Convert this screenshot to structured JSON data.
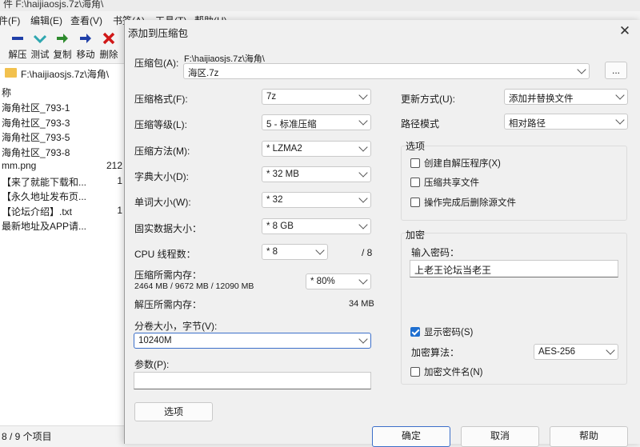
{
  "bg": {
    "title": "件 F:\\haijiaosjs.7z\\海角\\",
    "menu": [
      "件(F)",
      "编辑(E)",
      "查看(V)",
      "书签(A)",
      "工具(T)",
      "帮助(H)"
    ],
    "toolbar": [
      {
        "label": "解压",
        "icon": "minus-icon",
        "color": "#1f3fa8"
      },
      {
        "label": "测试",
        "icon": "check-icon",
        "color": "#2fa7b0"
      },
      {
        "label": "复制",
        "icon": "copy-arrow-icon",
        "color": "#2e8b2e"
      },
      {
        "label": "移动",
        "icon": "move-arrow-icon",
        "color": "#1f3fa8"
      },
      {
        "label": "删除",
        "icon": "delete-x-icon",
        "color": "#d01818"
      }
    ],
    "address": "F:\\haijiaosjs.7z\\海角\\",
    "list_header": "称",
    "files": [
      {
        "name": "海角社区_793-1",
        "size": ""
      },
      {
        "name": "海角社区_793-3",
        "size": ""
      },
      {
        "name": "海角社区_793-5",
        "size": ""
      },
      {
        "name": "海角社区_793-8",
        "size": ""
      },
      {
        "name": "mm.png",
        "size": "212"
      },
      {
        "name": "【来了就能下载和...",
        "size": "1"
      },
      {
        "name": "【永久地址发布页...",
        "size": ""
      },
      {
        "name": "【论坛介绍】.txt",
        "size": "1"
      },
      {
        "name": "最新地址及APP请...",
        "size": ""
      }
    ],
    "status": "8 / 9 个项目"
  },
  "dialog": {
    "title": "添加到压缩包",
    "archive_label": "压缩包(A):",
    "archive_path": "F:\\haijiaosjs.7z\\海角\\",
    "archive_name": "海区.7z",
    "browse_label": "...",
    "format_label": "压缩格式(F):",
    "format_value": "7z",
    "level_label": "压缩等级(L):",
    "level_value": "5 - 标准压缩",
    "method_label": "压缩方法(M):",
    "method_value": "* LZMA2",
    "dict_label": "字典大小(D):",
    "dict_value": "* 32 MB",
    "word_label": "单词大小(W):",
    "word_value": "* 32",
    "solid_label": "固实数据大小：",
    "solid_value": "* 8 GB",
    "cpu_label": "CPU 线程数：",
    "cpu_value": "* 8",
    "cpu_total": "/ 8",
    "mem_label": "压缩所需内存：",
    "mem_detail": "2464 MB / 9672 MB / 12090 MB",
    "mem_percent": "* 80%",
    "decomp_label": "解压所需内存：",
    "decomp_value": "34 MB",
    "volume_label": "分卷大小，字节(V):",
    "volume_value": "10240M",
    "params_label": "参数(P):",
    "params_value": "",
    "options_button": "选项",
    "update_label": "更新方式(U):",
    "update_value": "添加并替换文件",
    "path_label": "路径模式",
    "path_value": "相对路径",
    "options_group": "选项",
    "opt_sfx": "创建自解压程序(X)",
    "opt_shared": "压缩共享文件",
    "opt_delete": "操作完成后删除源文件",
    "enc_group": "加密",
    "pwd_label": "输入密码：",
    "pwd_value": "上老王论坛当老王",
    "show_pwd": "显示密码(S)",
    "enc_method_label": "加密算法：",
    "enc_method_value": "AES-256",
    "enc_names": "加密文件名(N)",
    "ok": "确定",
    "cancel": "取消",
    "help": "帮助"
  }
}
